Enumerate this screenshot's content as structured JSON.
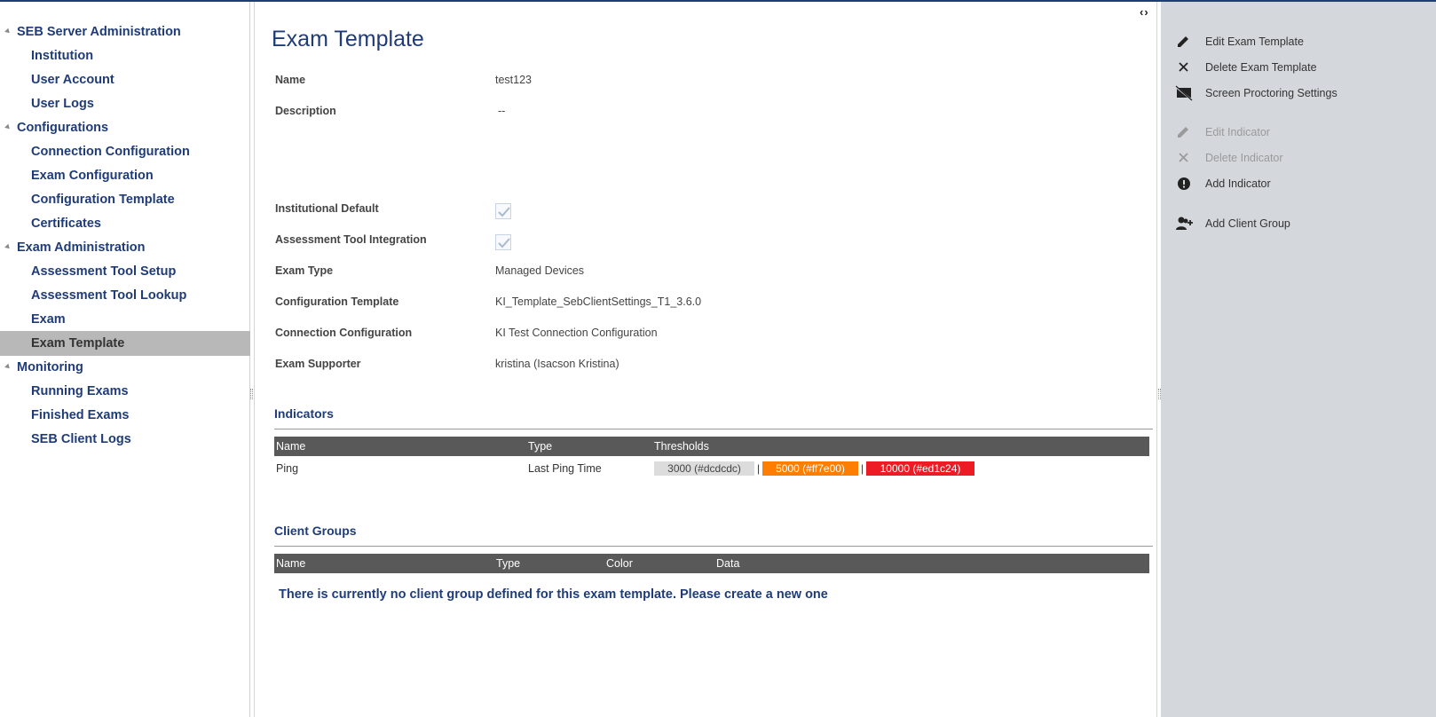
{
  "nav": {
    "groups": [
      {
        "label": "SEB Server Administration",
        "items": [
          "Institution",
          "User Account",
          "User Logs"
        ]
      },
      {
        "label": "Configurations",
        "items": [
          "Connection Configuration",
          "Exam Configuration",
          "Configuration Template",
          "Certificates"
        ]
      },
      {
        "label": "Exam Administration",
        "items": [
          "Assessment Tool Setup",
          "Assessment Tool Lookup",
          "Exam",
          "Exam Template"
        ]
      },
      {
        "label": "Monitoring",
        "items": [
          "Running Exams",
          "Finished Exams",
          "SEB Client Logs"
        ]
      }
    ],
    "active_item": "Exam Template"
  },
  "main": {
    "title": "Exam Template",
    "fields": {
      "name": {
        "label": "Name",
        "value": "test123"
      },
      "description": {
        "label": "Description",
        "value": "--"
      },
      "institutional_default": {
        "label": "Institutional Default",
        "checked": true
      },
      "assessment_tool_integration": {
        "label": "Assessment Tool Integration",
        "checked": true
      },
      "exam_type": {
        "label": "Exam Type",
        "value": "Managed Devices"
      },
      "configuration_template": {
        "label": "Configuration Template",
        "value": "KI_Template_SebClientSettings_T1_3.6.0"
      },
      "connection_configuration": {
        "label": "Connection Configuration",
        "value": "KI Test Connection Configuration"
      },
      "exam_supporter": {
        "label": "Exam Supporter",
        "value": "kristina (Isacson Kristina)"
      }
    },
    "indicators": {
      "title": "Indicators",
      "columns": [
        "Name",
        "Type",
        "Thresholds"
      ],
      "rows": [
        {
          "name": "Ping",
          "type": "Last Ping Time",
          "thresholds": [
            {
              "label": "3000 (#dcdcdc)",
              "color": "#dcdcdc",
              "text_color": "#444444"
            },
            {
              "label": "5000 (#ff7e00)",
              "color": "#ff7e00",
              "text_color": "#ffffff"
            },
            {
              "label": "10000 (#ed1c24)",
              "color": "#ed1c24",
              "text_color": "#ffffff"
            }
          ],
          "separator": "|"
        }
      ]
    },
    "client_groups": {
      "title": "Client Groups",
      "columns": [
        "Name",
        "Type",
        "Color",
        "Data"
      ],
      "empty_message": "There is currently no client group defined for this exam template. Please create a new one"
    }
  },
  "actions": {
    "edit_exam_template": {
      "label": "Edit Exam Template",
      "icon": "pencil-icon",
      "enabled": true
    },
    "delete_exam_template": {
      "label": "Delete Exam Template",
      "icon": "close-icon",
      "enabled": true
    },
    "screen_proctoring_settings": {
      "label": "Screen Proctoring Settings",
      "icon": "screen-off-icon",
      "enabled": true
    },
    "edit_indicator": {
      "label": "Edit Indicator",
      "icon": "pencil-icon",
      "enabled": false
    },
    "delete_indicator": {
      "label": "Delete Indicator",
      "icon": "close-icon",
      "enabled": false
    },
    "add_indicator": {
      "label": "Add Indicator",
      "icon": "alert-circle-icon",
      "enabled": true
    },
    "add_client_group": {
      "label": "Add Client Group",
      "icon": "add-group-icon",
      "enabled": true
    }
  },
  "colors": {
    "brand": "#1f3c78",
    "action_pane": "#d4d8dd",
    "table_header": "#595959",
    "nav_active": "#b8b8b8"
  }
}
